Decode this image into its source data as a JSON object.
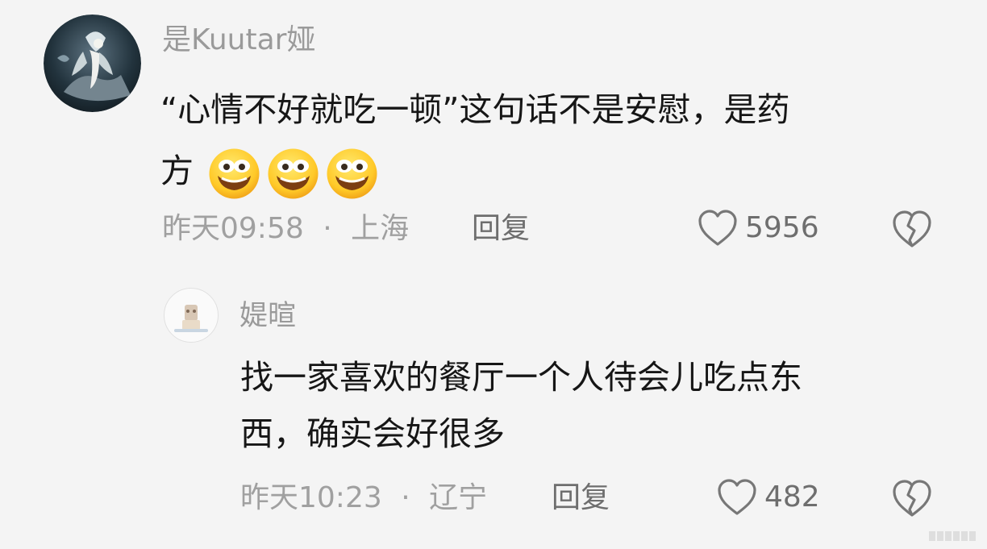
{
  "comments": [
    {
      "username": "是Kuutar娅",
      "content_line1": "“心情不好就吃一顿”这句话不是安慰，是药",
      "content_line2": "方",
      "emoji_icons": [
        "laughing-face-icon",
        "laughing-face-icon",
        "laughing-face-icon"
      ],
      "time": "昨天09:58",
      "separator": "·",
      "location": "上海",
      "reply_label": "回复",
      "like_count": "5956",
      "like_icon": "heart-outline-icon",
      "dislike_icon": "broken-heart-icon"
    },
    {
      "username": "媞暄",
      "content_line1": "找一家喜欢的餐厅一个人待会儿吃点东",
      "content_line2": "西，确实会好很多",
      "time": "昨天10:23",
      "separator": "·",
      "location": "辽宁",
      "reply_label": "回复",
      "like_count": "482",
      "like_icon": "heart-outline-icon",
      "dislike_icon": "broken-heart-icon"
    }
  ]
}
